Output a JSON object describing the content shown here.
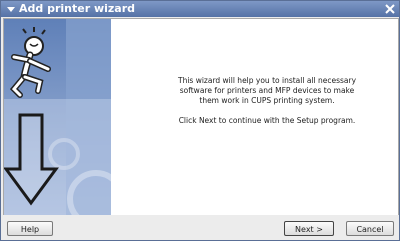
{
  "window": {
    "title": "Add printer wizard"
  },
  "content": {
    "paragraph1": "This wizard will help you to install all necessary software for printers and MFP devices to make them work in CUPS printing system.",
    "paragraph2": "Click Next to continue with the Setup program."
  },
  "buttons": {
    "help": "Help",
    "next": "Next >",
    "cancel": "Cancel"
  },
  "colors": {
    "titlebar": "#5572a6",
    "side_panel": "#7f9bc9"
  },
  "icons": [
    "title-menu-arrow-icon",
    "close-icon",
    "running-figure-icon",
    "down-arrow-icon"
  ]
}
